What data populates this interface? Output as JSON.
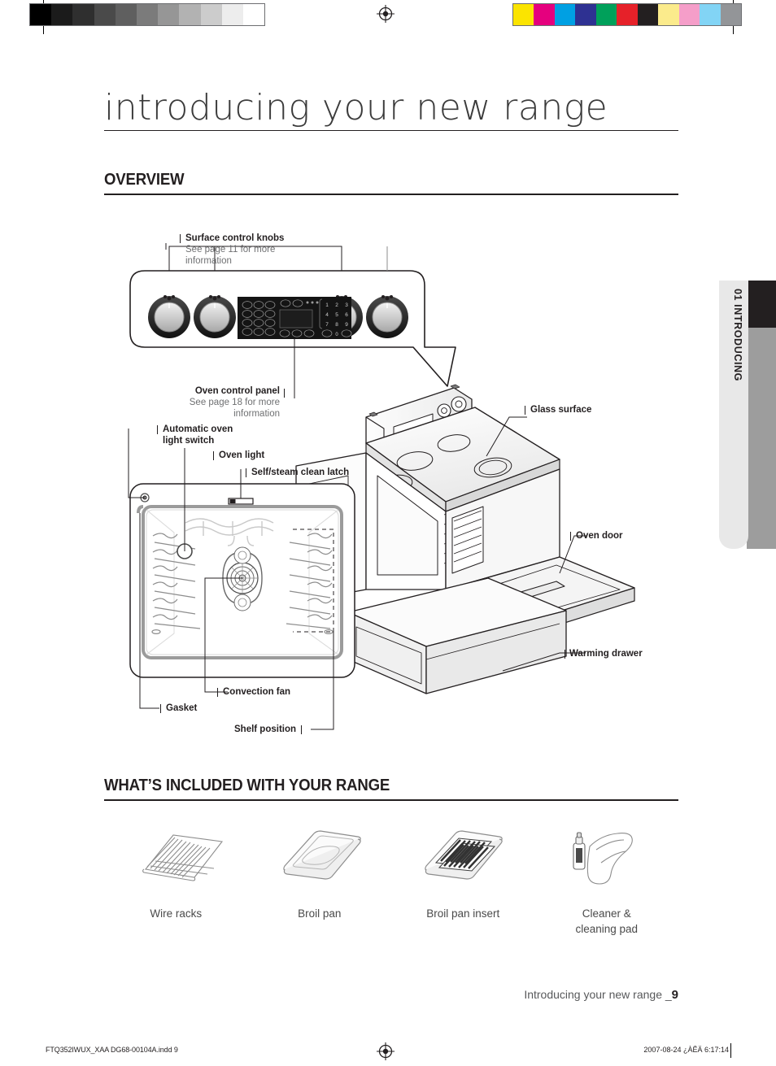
{
  "page": {
    "title": "introducing your new range",
    "side_tab": "01  INTRODUCING",
    "footer_text": "Introducing your new range _",
    "footer_page": "9",
    "doc_id": "FTQ352IWUX_XAA DG68-00104A.indd   9",
    "doc_date": "2007-08-24   ¿ÀÊÄ 6:17:14"
  },
  "sections": {
    "overview": "OVERVIEW",
    "included": "WHAT’S INCLUDED WITH YOUR RANGE"
  },
  "callouts": {
    "surface_control_knobs": {
      "title": "Surface control knobs",
      "sub1": "See page 11 for more",
      "sub2": "information"
    },
    "oven_control_panel": {
      "title": "Oven control panel",
      "sub1": "See page 18 for more",
      "sub2": "information"
    },
    "automatic_oven_light_switch_1": "Automatic oven",
    "automatic_oven_light_switch_2": "light switch",
    "oven_light": "Oven light",
    "self_steam_clean_latch": "Self/steam clean latch",
    "glass_surface": "Glass surface",
    "oven_door": "Oven door",
    "warming_drawer": "Warming drawer",
    "convection_fan": "Convection fan",
    "gasket": "Gasket",
    "shelf_position": "Shelf position"
  },
  "accessories": [
    {
      "name": "Wire racks",
      "icon": "wire-rack-icon"
    },
    {
      "name": "Broil pan",
      "icon": "broil-pan-icon"
    },
    {
      "name": "Broil pan insert",
      "icon": "broil-pan-insert-icon"
    },
    {
      "name": "Cleaner &\ncleaning pad",
      "icon": "cleaner-bottle-and-pad-icon"
    }
  ],
  "registration": {
    "greyscale_bar": [
      "#000000",
      "#1b1b1b",
      "#2f2f2f",
      "#4a4a4a",
      "#5f5f5f",
      "#7b7b7b",
      "#969696",
      "#b2b2b2",
      "#cccccc",
      "#ededed",
      "#ffffff"
    ],
    "color_bar": [
      "#fbe400",
      "#e5007e",
      "#00a0e3",
      "#2e3192",
      "#00a05a",
      "#e62129",
      "#231f20",
      "#fbeb8c",
      "#f59ec9",
      "#82d4f5",
      "#939598"
    ]
  },
  "colors": {
    "ink": "#231f20",
    "muted": "#6f7072",
    "tab_bg": "#e8e8e8",
    "tab_grey": "#9d9d9d"
  }
}
